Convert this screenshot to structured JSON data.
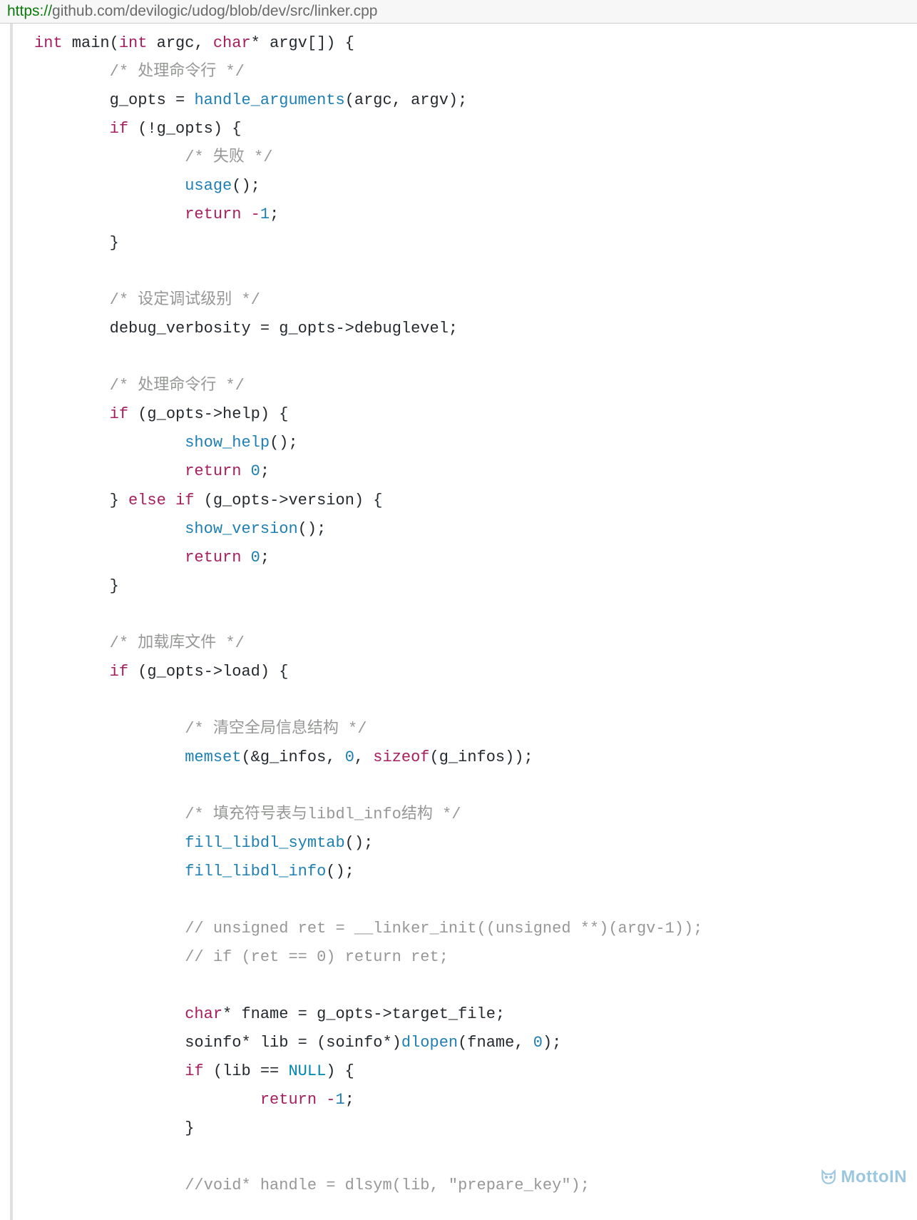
{
  "url": {
    "scheme": "https://",
    "host_path": "github.com/devilogic/udog/blob/dev/src/linker.cpp"
  },
  "watermark": "MottoIN",
  "code": {
    "lines": [
      {
        "indent": 0,
        "tokens": [
          {
            "t": "kw",
            "v": "int"
          },
          {
            "t": "pl",
            "v": " main("
          },
          {
            "t": "kw",
            "v": "int"
          },
          {
            "t": "pl",
            "v": " argc, "
          },
          {
            "t": "kw",
            "v": "char"
          },
          {
            "t": "pl",
            "v": "* argv[]) {"
          }
        ]
      },
      {
        "indent": 2,
        "tokens": [
          {
            "t": "cmt",
            "v": "/* 处理命令行 */"
          }
        ]
      },
      {
        "indent": 2,
        "tokens": [
          {
            "t": "pl",
            "v": "g_opts = "
          },
          {
            "t": "fn",
            "v": "handle_arguments"
          },
          {
            "t": "pl",
            "v": "(argc, argv);"
          }
        ]
      },
      {
        "indent": 2,
        "tokens": [
          {
            "t": "kw",
            "v": "if"
          },
          {
            "t": "pl",
            "v": " (!g_opts) {"
          }
        ]
      },
      {
        "indent": 4,
        "tokens": [
          {
            "t": "cmt",
            "v": "/* 失败 */"
          }
        ]
      },
      {
        "indent": 4,
        "tokens": [
          {
            "t": "fn",
            "v": "usage"
          },
          {
            "t": "pl",
            "v": "();"
          }
        ]
      },
      {
        "indent": 4,
        "tokens": [
          {
            "t": "kw",
            "v": "return"
          },
          {
            "t": "pl",
            "v": " "
          },
          {
            "t": "neg",
            "v": "-"
          },
          {
            "t": "num",
            "v": "1"
          },
          {
            "t": "pl",
            "v": ";"
          }
        ]
      },
      {
        "indent": 2,
        "tokens": [
          {
            "t": "pl",
            "v": "}"
          }
        ]
      },
      {
        "blank": true
      },
      {
        "indent": 2,
        "tokens": [
          {
            "t": "cmt",
            "v": "/* 设定调试级别 */"
          }
        ]
      },
      {
        "indent": 2,
        "tokens": [
          {
            "t": "pl",
            "v": "debug_verbosity = g_opts->debuglevel;"
          }
        ]
      },
      {
        "blank": true
      },
      {
        "indent": 2,
        "tokens": [
          {
            "t": "cmt",
            "v": "/* 处理命令行 */"
          }
        ]
      },
      {
        "indent": 2,
        "tokens": [
          {
            "t": "kw",
            "v": "if"
          },
          {
            "t": "pl",
            "v": " (g_opts->help) {"
          }
        ]
      },
      {
        "indent": 4,
        "tokens": [
          {
            "t": "fn",
            "v": "show_help"
          },
          {
            "t": "pl",
            "v": "();"
          }
        ]
      },
      {
        "indent": 4,
        "tokens": [
          {
            "t": "kw",
            "v": "return"
          },
          {
            "t": "pl",
            "v": " "
          },
          {
            "t": "num",
            "v": "0"
          },
          {
            "t": "pl",
            "v": ";"
          }
        ]
      },
      {
        "indent": 2,
        "tokens": [
          {
            "t": "pl",
            "v": "} "
          },
          {
            "t": "kw",
            "v": "else"
          },
          {
            "t": "pl",
            "v": " "
          },
          {
            "t": "kw",
            "v": "if"
          },
          {
            "t": "pl",
            "v": " (g_opts->version) {"
          }
        ]
      },
      {
        "indent": 4,
        "tokens": [
          {
            "t": "fn",
            "v": "show_version"
          },
          {
            "t": "pl",
            "v": "();"
          }
        ]
      },
      {
        "indent": 4,
        "tokens": [
          {
            "t": "kw",
            "v": "return"
          },
          {
            "t": "pl",
            "v": " "
          },
          {
            "t": "num",
            "v": "0"
          },
          {
            "t": "pl",
            "v": ";"
          }
        ]
      },
      {
        "indent": 2,
        "tokens": [
          {
            "t": "pl",
            "v": "}"
          }
        ]
      },
      {
        "blank": true
      },
      {
        "indent": 2,
        "tokens": [
          {
            "t": "cmt",
            "v": "/* 加载库文件 */"
          }
        ]
      },
      {
        "indent": 2,
        "tokens": [
          {
            "t": "kw",
            "v": "if"
          },
          {
            "t": "pl",
            "v": " (g_opts->load) {"
          }
        ]
      },
      {
        "blank": true
      },
      {
        "indent": 4,
        "tokens": [
          {
            "t": "cmt",
            "v": "/* 清空全局信息结构 */"
          }
        ]
      },
      {
        "indent": 4,
        "tokens": [
          {
            "t": "fn",
            "v": "memset"
          },
          {
            "t": "pl",
            "v": "(&g_infos, "
          },
          {
            "t": "num",
            "v": "0"
          },
          {
            "t": "pl",
            "v": ", "
          },
          {
            "t": "kw",
            "v": "sizeof"
          },
          {
            "t": "pl",
            "v": "(g_infos));"
          }
        ]
      },
      {
        "blank": true
      },
      {
        "indent": 4,
        "tokens": [
          {
            "t": "cmt",
            "v": "/* 填充符号表与libdl_info结构 */"
          }
        ]
      },
      {
        "indent": 4,
        "tokens": [
          {
            "t": "fn",
            "v": "fill_libdl_symtab"
          },
          {
            "t": "pl",
            "v": "();"
          }
        ]
      },
      {
        "indent": 4,
        "tokens": [
          {
            "t": "fn",
            "v": "fill_libdl_info"
          },
          {
            "t": "pl",
            "v": "();"
          }
        ]
      },
      {
        "blank": true
      },
      {
        "indent": 4,
        "tokens": [
          {
            "t": "cmt",
            "v": "// unsigned ret = __linker_init((unsigned **)(argv-1));"
          }
        ]
      },
      {
        "indent": 4,
        "tokens": [
          {
            "t": "cmt",
            "v": "// if (ret == 0) return ret;"
          }
        ]
      },
      {
        "blank": true
      },
      {
        "indent": 4,
        "tokens": [
          {
            "t": "kw",
            "v": "char"
          },
          {
            "t": "pl",
            "v": "* fname = g_opts->target_file;"
          }
        ]
      },
      {
        "indent": 4,
        "tokens": [
          {
            "t": "pl",
            "v": "soinfo* lib = (soinfo*)"
          },
          {
            "t": "fn",
            "v": "dlopen"
          },
          {
            "t": "pl",
            "v": "(fname, "
          },
          {
            "t": "num",
            "v": "0"
          },
          {
            "t": "pl",
            "v": ");"
          }
        ]
      },
      {
        "indent": 4,
        "tokens": [
          {
            "t": "kw",
            "v": "if"
          },
          {
            "t": "pl",
            "v": " (lib == "
          },
          {
            "t": "const",
            "v": "NULL"
          },
          {
            "t": "pl",
            "v": ") {"
          }
        ]
      },
      {
        "indent": 6,
        "tokens": [
          {
            "t": "kw",
            "v": "return"
          },
          {
            "t": "pl",
            "v": " "
          },
          {
            "t": "neg",
            "v": "-"
          },
          {
            "t": "num",
            "v": "1"
          },
          {
            "t": "pl",
            "v": ";"
          }
        ]
      },
      {
        "indent": 4,
        "tokens": [
          {
            "t": "pl",
            "v": "}"
          }
        ]
      },
      {
        "blank": true
      },
      {
        "indent": 4,
        "tokens": [
          {
            "t": "cmt",
            "v": "//void* handle = dlsym(lib, \"prepare_key\");"
          }
        ]
      }
    ]
  }
}
